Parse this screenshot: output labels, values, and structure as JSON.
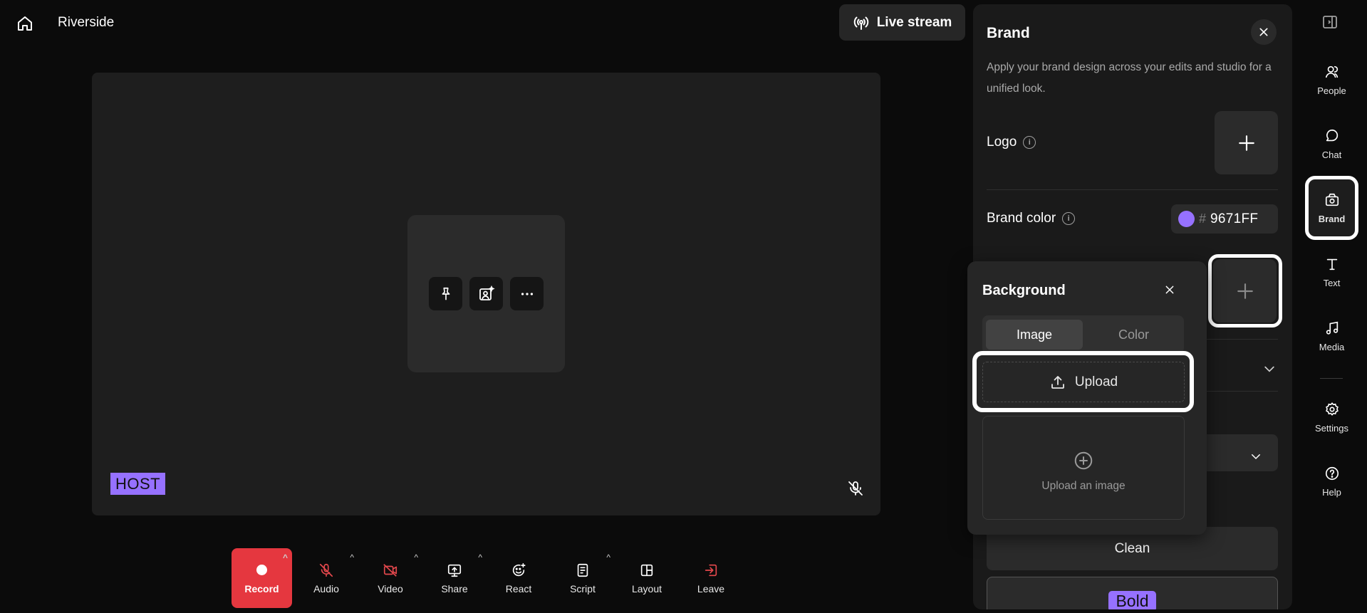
{
  "app": {
    "title": "Riverside"
  },
  "header": {
    "live_stream_label": "Live stream"
  },
  "stage": {
    "host_badge": "HOST"
  },
  "toolbar": {
    "record": "Record",
    "audio": "Audio",
    "video": "Video",
    "share": "Share",
    "react": "React",
    "script": "Script",
    "layout": "Layout",
    "leave": "Leave",
    "caret": "^"
  },
  "brand_panel": {
    "title": "Brand",
    "description": "Apply your brand design across your edits and studio for a unified look.",
    "logo_label": "Logo",
    "brand_color_label": "Brand color",
    "brand_color_hash": "#",
    "brand_color_value": "9671FF",
    "info_glyph": "i",
    "style_clean": "Clean",
    "style_bold": "Bold"
  },
  "background_popover": {
    "title": "Background",
    "tab_image": "Image",
    "tab_color": "Color",
    "upload_label": "Upload",
    "upload_area_label": "Upload an image"
  },
  "rail": {
    "people": "People",
    "chat": "Chat",
    "brand": "Brand",
    "text": "Text",
    "media": "Media",
    "settings": "Settings",
    "help": "Help"
  },
  "colors": {
    "accent": "#9671FF",
    "record": "#E5373F",
    "muted_red": "#E5484D",
    "panel": "#1A1A1A",
    "stage": "#1E1E1E"
  }
}
